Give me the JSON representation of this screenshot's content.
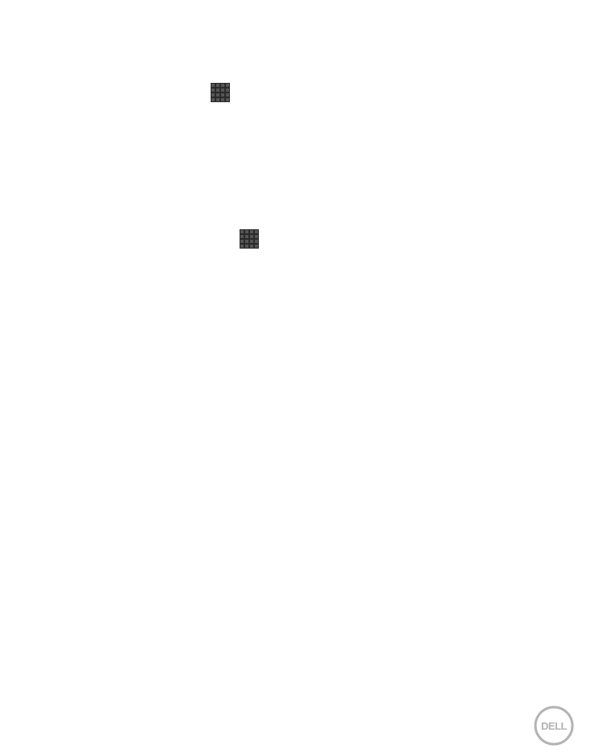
{
  "page": {
    "background_color": "#ffffff"
  },
  "icons": [
    {
      "name": "apps-grid-icon",
      "color": "#3a3a3a"
    },
    {
      "name": "apps-grid-icon",
      "color": "#3a3a3a"
    }
  ],
  "footer": {
    "logo": {
      "text": "DELL",
      "color": "#b3b3b3"
    }
  }
}
